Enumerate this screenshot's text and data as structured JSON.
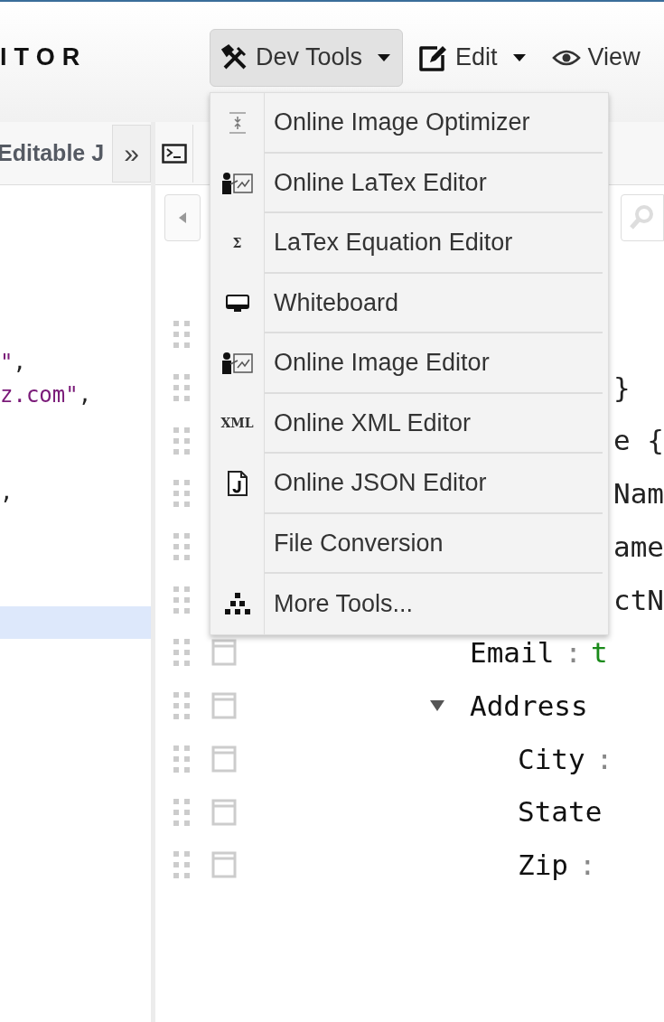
{
  "header": {
    "title": "ITOR",
    "menus": [
      {
        "label": "Dev Tools",
        "kind": "tools",
        "open": true,
        "caret": true
      },
      {
        "label": "Edit",
        "kind": "edit",
        "open": false,
        "caret": true
      },
      {
        "label": "View",
        "kind": "eye",
        "open": false,
        "caret": false
      }
    ]
  },
  "dropdown": {
    "items": [
      {
        "label": "Online Image Optimizer",
        "kind": "compress"
      },
      {
        "label": "Online LaTex Editor",
        "kind": "presenter"
      },
      {
        "label": "LaTex Equation Editor",
        "kind": "glyph",
        "glyph": "Σ"
      },
      {
        "label": "Whiteboard",
        "kind": "monitor"
      },
      {
        "label": "Online Image Editor",
        "kind": "presenter"
      },
      {
        "label": "Online XML Editor",
        "kind": "glyph",
        "glyph": "XML"
      },
      {
        "label": "Online JSON Editor",
        "kind": "jsonfile"
      },
      {
        "label": "File Conversion",
        "kind": "plain"
      },
      {
        "label": "More Tools...",
        "kind": "pyramid"
      }
    ]
  },
  "left_pane": {
    "tab": "Editable J",
    "collapse": "»",
    "lines": [
      {
        "selected": false,
        "parts": [
          {
            "text": "\"",
            "kind": "string"
          },
          {
            "text": ",",
            "kind": "punct"
          }
        ]
      },
      {
        "selected": false,
        "parts": [
          {
            "text": "z.com\"",
            "kind": "string"
          },
          {
            "text": ",",
            "kind": "punct"
          }
        ]
      },
      {
        "selected": false
      },
      {
        "selected": false
      },
      {
        "selected": false,
        "parts": [
          {
            "text": ",",
            "kind": "punct"
          }
        ]
      },
      {
        "selected": false
      },
      {
        "selected": false
      },
      {
        "selected": false
      },
      {
        "selected": true
      }
    ]
  },
  "tree": {
    "rows": [
      {
        "text": ""
      },
      {
        "text": "}"
      },
      {
        "text": "e {"
      },
      {
        "text": "Nam"
      },
      {
        "text": "ame"
      },
      {
        "text": "ctN"
      }
    ],
    "nodes": [
      {
        "key": "Email",
        "separator": ":",
        "value": "t"
      },
      {
        "key": "Address",
        "expanded": true,
        "children": [
          {
            "key": "City",
            "separator": ":"
          },
          {
            "key": "State"
          },
          {
            "key": "Zip",
            "separator": ":"
          }
        ]
      }
    ]
  }
}
